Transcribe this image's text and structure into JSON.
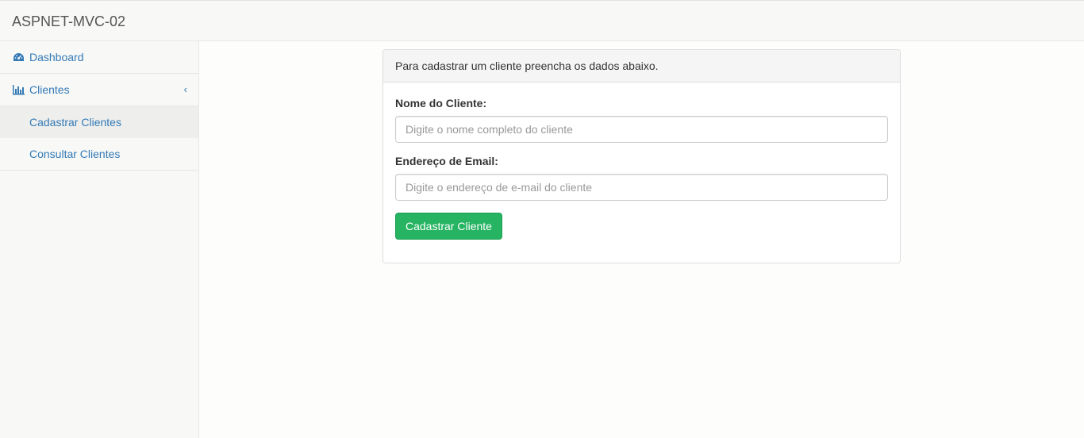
{
  "app": {
    "brand": "ASPNET-MVC-02"
  },
  "sidebar": {
    "items": [
      {
        "label": "Dashboard",
        "icon": "dashboard-icon"
      },
      {
        "label": "Clientes",
        "icon": "bar-chart-icon",
        "chevron": "‹"
      }
    ],
    "subitems": [
      {
        "label": "Cadastrar Clientes",
        "active": true
      },
      {
        "label": "Consultar Clientes",
        "active": false
      }
    ]
  },
  "form": {
    "heading": "Para cadastrar um cliente preencha os dados abaixo.",
    "name_label": "Nome do Cliente:",
    "name_placeholder": "Digite o nome completo do cliente",
    "name_value": "",
    "email_label": "Endereço de Email:",
    "email_placeholder": "Digite o endereço de e-mail do cliente",
    "email_value": "",
    "submit_label": "Cadastrar Cliente"
  },
  "colors": {
    "link": "#337ab7",
    "success": "#26b462"
  }
}
